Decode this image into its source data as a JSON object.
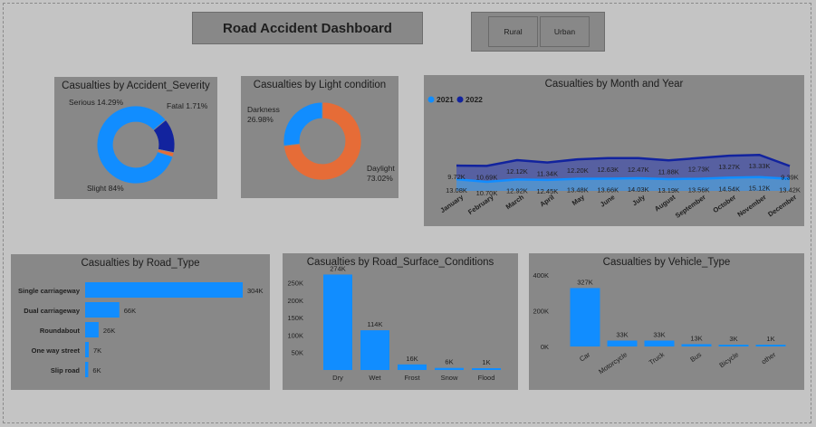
{
  "dashboard": {
    "title": "Road Accident Dashboard",
    "filters": [
      "Rural",
      "Urban"
    ]
  },
  "colors": {
    "panel": "#888888",
    "blue": "#118dff",
    "navy": "#12239e",
    "orange": "#e66c37"
  },
  "chart_data": [
    {
      "type": "pie",
      "title": "Casualties by Accident_Severity",
      "slices": [
        {
          "label": "Slight",
          "percent": 84,
          "text": "Slight 84%",
          "color": "#118dff"
        },
        {
          "label": "Serious",
          "percent": 14.29,
          "text": "Serious 14.29%",
          "color": "#12239e"
        },
        {
          "label": "Fatal",
          "percent": 1.71,
          "text": "Fatal 1.71%",
          "color": "#e66c37"
        }
      ]
    },
    {
      "type": "pie",
      "title": "Casualties by Light condition",
      "slices": [
        {
          "label": "Darkness",
          "percent": 26.98,
          "text": "Darkness 26.98%",
          "color": "#118dff"
        },
        {
          "label": "Daylight",
          "percent": 73.02,
          "text": "Daylight 73.02%",
          "color": "#e66c37"
        }
      ]
    },
    {
      "type": "area",
      "title": "Casualties by Month and Year",
      "legend": "top-left",
      "categories": [
        "January",
        "February",
        "March",
        "April",
        "May",
        "June",
        "July",
        "August",
        "September",
        "October",
        "November",
        "December"
      ],
      "series": [
        {
          "name": "2021",
          "color": "#118dff",
          "values": [
            13.08,
            10.7,
            12.92,
            12.45,
            13.48,
            13.66,
            14.03,
            13.19,
            13.56,
            14.54,
            15.12,
            13.42
          ],
          "labels": [
            "13.08K",
            "10.70K",
            "12.92K",
            "12.45K",
            "13.48K",
            "13.66K",
            "14.03K",
            "13.19K",
            "13.56K",
            "14.54K",
            "15.12K",
            "13.42K"
          ]
        },
        {
          "name": "2022",
          "color": "#12239e",
          "values": [
            9.72,
            10.69,
            12.12,
            11.34,
            12.2,
            12.63,
            12.47,
            11.88,
            12.73,
            13.27,
            13.33,
            9.39
          ],
          "labels": [
            "9.72K",
            "10.69K",
            "12.12K",
            "11.34K",
            "12.20K",
            "12.63K",
            "12.47K",
            "11.88K",
            "12.73K",
            "13.27K",
            "13.33K",
            "9.39K"
          ]
        }
      ]
    },
    {
      "type": "bar",
      "orientation": "horizontal",
      "title": "Casualties by Road_Type",
      "categories": [
        "Single carriageway",
        "Dual carriageway",
        "Roundabout",
        "One way street",
        "Slip road"
      ],
      "values": [
        304,
        66,
        26,
        7,
        6
      ],
      "labels": [
        "304K",
        "66K",
        "26K",
        "7K",
        "6K"
      ],
      "unit": "thousands"
    },
    {
      "type": "bar",
      "title": "Casualties by Road_Surface_Conditions",
      "categories": [
        "Dry",
        "Wet",
        "Frost",
        "Snow",
        "Flood"
      ],
      "values": [
        274,
        114,
        16,
        6,
        1
      ],
      "labels": [
        "274K",
        "114K",
        "16K",
        "6K",
        "1K"
      ],
      "unit": "thousands",
      "yticks": [
        "50K",
        "100K",
        "150K",
        "200K",
        "250K"
      ],
      "ytick_values": [
        50,
        100,
        150,
        200,
        250
      ],
      "ylim": [
        0,
        270
      ]
    },
    {
      "type": "bar",
      "title": "Casualties by Vehicle_Type",
      "categories": [
        "Car",
        "Motorcycle",
        "Truck",
        "Bus",
        "Bicycle",
        "other"
      ],
      "values": [
        327,
        33,
        33,
        13,
        3,
        1
      ],
      "labels": [
        "327K",
        "33K",
        "33K",
        "13K",
        "3K",
        "1K"
      ],
      "unit": "thousands",
      "yticks": [
        "0K",
        "200K",
        "400K"
      ],
      "ytick_values": [
        0,
        200,
        400
      ],
      "ylim": [
        0,
        400
      ]
    }
  ]
}
